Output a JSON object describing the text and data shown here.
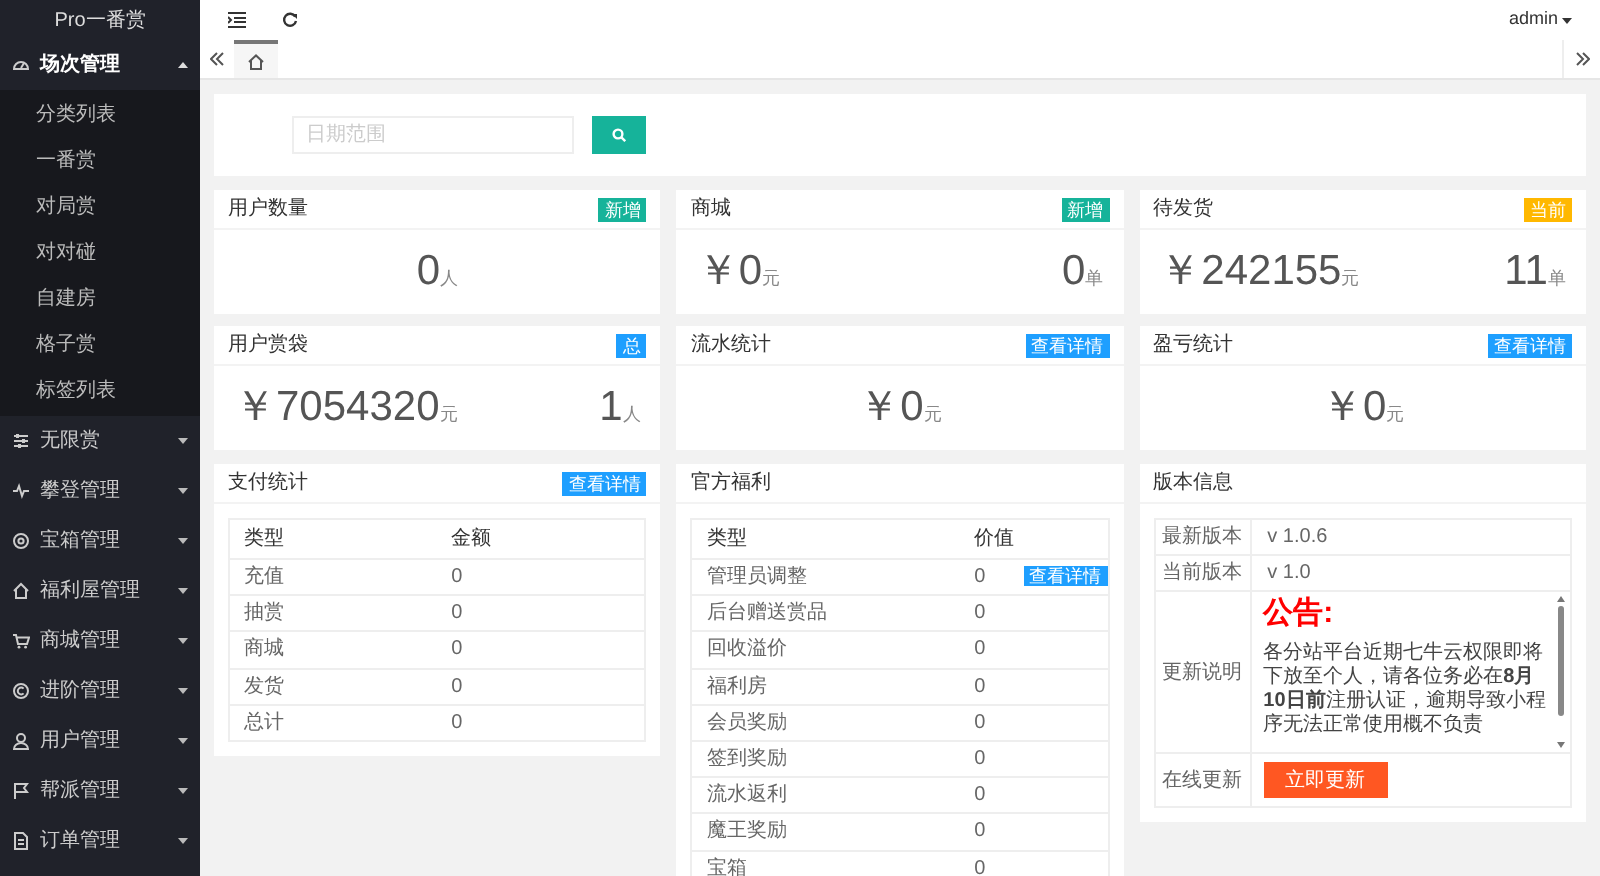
{
  "sidebar": {
    "title": "Pro一番赏",
    "groups": [
      {
        "label": "场次管理",
        "expanded": true,
        "children": [
          {
            "label": "分类列表"
          },
          {
            "label": "一番赏"
          },
          {
            "label": "对局赏"
          },
          {
            "label": "对对碰"
          },
          {
            "label": "自建房"
          },
          {
            "label": "格子赏"
          },
          {
            "label": "标签列表"
          }
        ]
      },
      {
        "label": "无限赏",
        "expanded": false
      },
      {
        "label": "攀登管理",
        "expanded": false
      },
      {
        "label": "宝箱管理",
        "expanded": false
      },
      {
        "label": "福利屋管理",
        "expanded": false
      },
      {
        "label": "商城管理",
        "expanded": false
      },
      {
        "label": "进阶管理",
        "expanded": false
      },
      {
        "label": "用户管理",
        "expanded": false
      },
      {
        "label": "帮派管理",
        "expanded": false
      },
      {
        "label": "订单管理",
        "expanded": false
      }
    ]
  },
  "topbar": {
    "user": "admin"
  },
  "filter": {
    "placeholder": "日期范围"
  },
  "stat_cards": [
    {
      "title": "用户数量",
      "badge": {
        "label": "新增",
        "color": "#16b39a"
      },
      "values": [
        {
          "amount": "0",
          "unit": "人"
        }
      ]
    },
    {
      "title": "商城",
      "badge": {
        "label": "新增",
        "color": "#16b39a"
      },
      "values": [
        {
          "amount": "￥0",
          "unit": "元"
        },
        {
          "amount": "0",
          "unit": "单"
        }
      ]
    },
    {
      "title": "待发货",
      "badge": {
        "label": "当前",
        "color": "#ffb800"
      },
      "values": [
        {
          "amount": "￥242155",
          "unit": "元"
        },
        {
          "amount": "11",
          "unit": "单"
        }
      ]
    },
    {
      "title": "用户赏袋",
      "badge": {
        "label": "总",
        "color": "#1e9fff"
      },
      "values": [
        {
          "amount": "￥7054320",
          "unit": "元"
        },
        {
          "amount": "1",
          "unit": "人"
        }
      ]
    },
    {
      "title": "流水统计",
      "badge": {
        "label": "查看详情",
        "color": "#1e9fff"
      },
      "values": [
        {
          "amount": "￥0",
          "unit": "元"
        }
      ]
    },
    {
      "title": "盈亏统计",
      "badge": {
        "label": "查看详情",
        "color": "#1e9fff"
      },
      "values": [
        {
          "amount": "￥0",
          "unit": "元"
        }
      ]
    }
  ],
  "payment": {
    "title": "支付统计",
    "badge": {
      "label": "查看详情",
      "color": "#1e9fff"
    },
    "columns": [
      "类型",
      "金额"
    ],
    "rows": [
      [
        "充值",
        "0"
      ],
      [
        "抽赏",
        "0"
      ],
      [
        "商城",
        "0"
      ],
      [
        "发货",
        "0"
      ],
      [
        "总计",
        "0"
      ]
    ]
  },
  "welfare": {
    "title": "官方福利",
    "columns": [
      "类型",
      "价值"
    ],
    "rows": [
      {
        "type": "管理员调整",
        "value": "0",
        "action": "查看详情"
      },
      {
        "type": "后台赠送赏品",
        "value": "0"
      },
      {
        "type": "回收溢价",
        "value": "0"
      },
      {
        "type": "福利房",
        "value": "0"
      },
      {
        "type": "会员奖励",
        "value": "0"
      },
      {
        "type": "签到奖励",
        "value": "0"
      },
      {
        "type": "流水返利",
        "value": "0"
      },
      {
        "type": "魔王奖励",
        "value": "0"
      },
      {
        "type": "宝箱",
        "value": "0"
      }
    ]
  },
  "version": {
    "title": "版本信息",
    "latest_label": "最新版本",
    "latest": "v 1.0.6",
    "current_label": "当前版本",
    "current": "v 1.0",
    "notes_label": "更新说明",
    "notice_title": "公告:",
    "notice_body": "各分站平台近期七牛云权限即将下放至个人，请各位务必在**8月10日前**注册认证，逾期导致小程序无法正常使用概不负责",
    "update_label": "在线更新",
    "update_button": "立即更新"
  }
}
